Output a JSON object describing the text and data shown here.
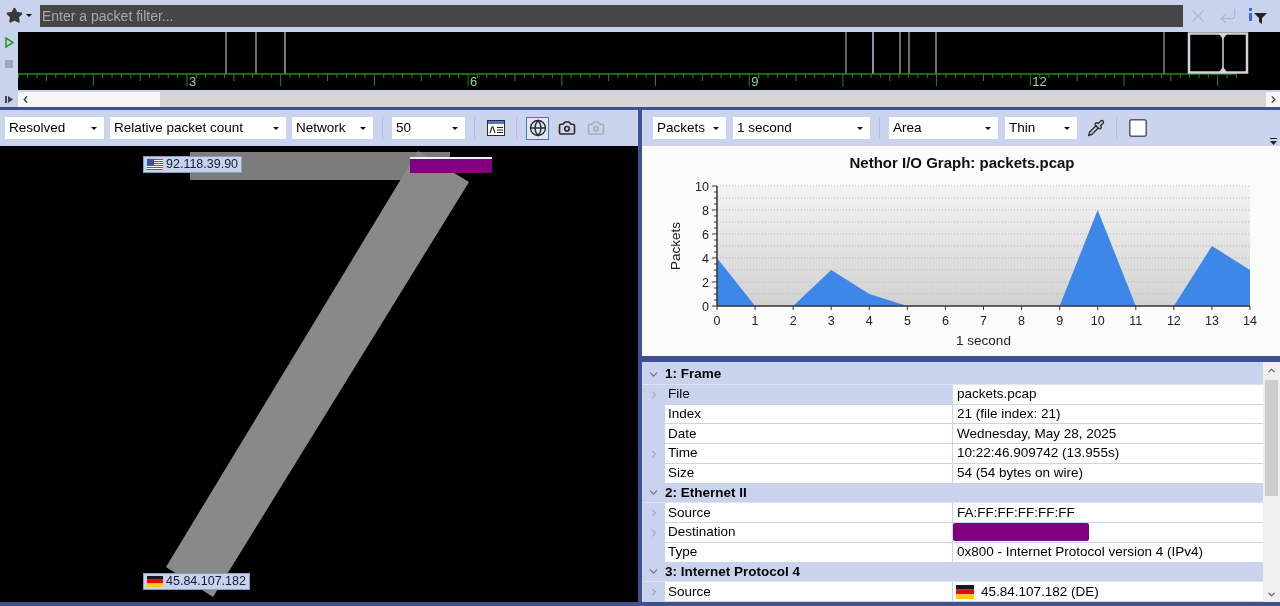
{
  "filter_bar": {
    "placeholder": "Enter a packet filter...",
    "buttons": [
      {
        "kind": "clear",
        "disabled": true
      },
      {
        "kind": "apply",
        "disabled": true
      },
      {
        "kind": "info",
        "disabled": false
      }
    ]
  },
  "timeline": {
    "ruler_labels": [
      "3",
      "6",
      "9",
      "12"
    ]
  },
  "left_pane": {
    "toolbar": {
      "groups": [
        {
          "items": [
            {
              "kind": "dropdown",
              "value": "Resolved"
            },
            {
              "kind": "dropdown",
              "value": "Relative packet count"
            },
            {
              "kind": "dropdown",
              "value": "Network"
            }
          ]
        },
        {
          "items": [
            {
              "kind": "dropdown",
              "value": "50"
            }
          ]
        },
        {
          "items": [
            {
              "kind": "window",
              "selected": false,
              "disabled": false
            }
          ]
        },
        {
          "items": [
            {
              "kind": "globe",
              "selected": true,
              "disabled": false
            },
            {
              "kind": "camera",
              "selected": false,
              "disabled": false
            },
            {
              "kind": "camera",
              "selected": false,
              "disabled": true
            }
          ]
        }
      ]
    },
    "graph": {
      "hosts": [
        {
          "kind": "us",
          "address": "92.118.39.90"
        },
        {
          "kind": "de",
          "address": "45.84.107.182"
        }
      ]
    }
  },
  "right_pane": {
    "toolbar": {
      "groups": [
        {
          "items": [
            {
              "kind": "dropdown",
              "value": "Packets"
            },
            {
              "kind": "dropdown",
              "value": "1 second"
            }
          ]
        },
        {
          "items": [
            {
              "kind": "dropdown",
              "value": "Area"
            },
            {
              "kind": "dropdown",
              "value": "Thin"
            },
            {
              "kind": "eyedropper"
            }
          ]
        },
        {
          "items": [
            {
              "kind": "square"
            }
          ]
        }
      ]
    },
    "io_graph": {
      "chart_data": {
        "type": "area",
        "title": "Nethor I/O Graph: packets.pcap",
        "xlabel": "1 second",
        "ylabel": "Packets",
        "x": [
          0,
          1,
          2,
          3,
          4,
          5,
          6,
          7,
          8,
          9,
          10,
          11,
          12,
          13,
          14
        ],
        "series": [
          {
            "color": "#3d87e8",
            "values": [
              4,
              0,
              0,
              3,
              1,
              0,
              0,
              0,
              0,
              0,
              8,
              0,
              0,
              5,
              3
            ]
          }
        ],
        "xlim": [
          0,
          14
        ],
        "ylim": [
          0,
          10
        ],
        "xticks": [
          0,
          1,
          2,
          3,
          4,
          5,
          6,
          7,
          8,
          9,
          10,
          11,
          12,
          13,
          14
        ],
        "yticks": [
          0,
          2,
          4,
          6,
          8,
          10
        ],
        "grid": true
      }
    },
    "details": {
      "sections": [
        {
          "title": "1: Frame",
          "expanded": true,
          "rows": [
            {
              "label": "File",
              "value": "packets.pcap",
              "kind": "text",
              "expandable": true,
              "selected": true
            },
            {
              "label": "Index",
              "value": "21 (file index: 21)",
              "kind": "text",
              "expandable": false,
              "selected": false
            },
            {
              "label": "Date",
              "value": "Wednesday, May 28, 2025",
              "kind": "text",
              "expandable": false,
              "selected": false
            },
            {
              "label": "Time",
              "value": "10:22:46.909742 (13.955s)",
              "kind": "text",
              "expandable": true,
              "selected": false
            },
            {
              "label": "Size",
              "value": "54 (54 bytes on wire)",
              "kind": "text",
              "expandable": false,
              "selected": false
            }
          ]
        },
        {
          "title": "2: Ethernet II",
          "expanded": true,
          "rows": [
            {
              "label": "Source",
              "value": "FA:FF:FF:FF:FF:FF",
              "kind": "text",
              "expandable": true,
              "selected": false
            },
            {
              "label": "Destination",
              "kind": "redacted",
              "expandable": true,
              "selected": false
            },
            {
              "label": "Type",
              "value": "0x800 - Internet Protocol version 4 (IPv4)",
              "kind": "text",
              "expandable": false,
              "selected": false
            }
          ]
        },
        {
          "title": "3: Internet Protocol 4",
          "expanded": true,
          "rows": [
            {
              "label": "Source",
              "value": "45.84.107.182 (DE)",
              "kind": "de",
              "expandable": true,
              "selected": false
            }
          ]
        }
      ]
    }
  }
}
